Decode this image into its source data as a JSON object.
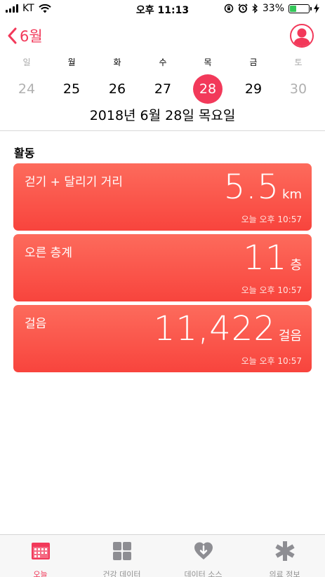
{
  "status_bar": {
    "carrier": "KT",
    "time": "오후 11:13",
    "battery_percent": "33%",
    "battery_level": 0.33,
    "battery_color": "#34c759"
  },
  "nav": {
    "back_label": "6월",
    "accent_color": "#f2395a"
  },
  "week": {
    "weekdays": [
      "일",
      "월",
      "화",
      "수",
      "목",
      "금",
      "토"
    ],
    "dates": [
      "24",
      "25",
      "26",
      "27",
      "28",
      "29",
      "30"
    ],
    "selected_index": 4,
    "full_date": "2018년 6월 28일 목요일"
  },
  "section": {
    "title": "활동"
  },
  "cards": [
    {
      "label": "걷기 + 달리기 거리",
      "value": "5.5",
      "unit": "km",
      "time": "오늘 오후 10:57"
    },
    {
      "label": "오른 층계",
      "value": "11",
      "unit": "층",
      "time": "오늘 오후 10:57"
    },
    {
      "label": "걸음",
      "value": "11,422",
      "unit": "걸음",
      "time": "오늘 오후 10:57"
    }
  ],
  "tabs": [
    {
      "label": "오늘",
      "icon": "calendar-icon",
      "active": true
    },
    {
      "label": "건강 데이터",
      "icon": "grid-icon",
      "active": false
    },
    {
      "label": "데이터 소스",
      "icon": "heart-download-icon",
      "active": false
    },
    {
      "label": "의료 정보",
      "icon": "asterisk-icon",
      "active": false
    }
  ]
}
